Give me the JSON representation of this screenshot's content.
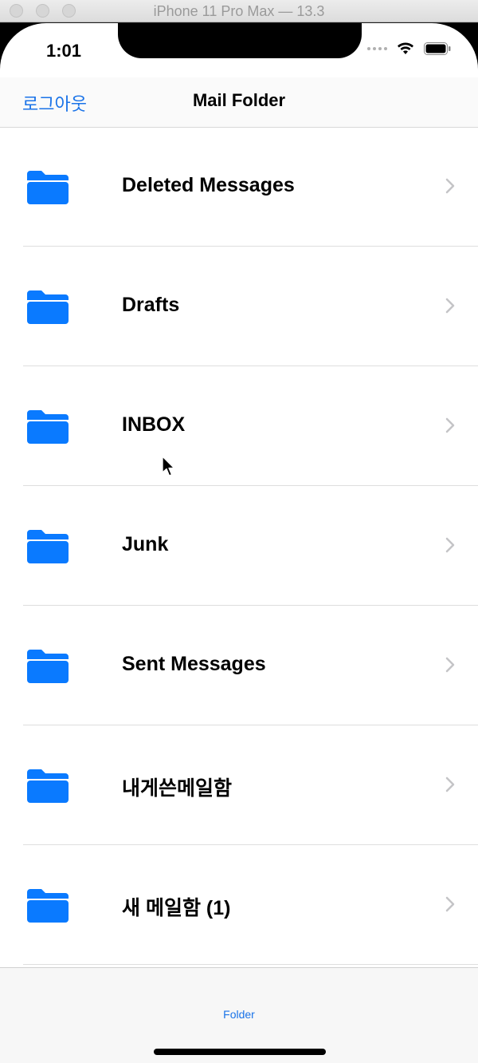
{
  "window": {
    "title": "iPhone 11 Pro Max — 13.3"
  },
  "status_bar": {
    "time": "1:01",
    "icons": [
      "cellular-dots-icon",
      "wifi-icon",
      "battery-icon"
    ]
  },
  "nav": {
    "left_button": "로그아웃",
    "title": "Mail Folder"
  },
  "folders": [
    {
      "label": "Deleted Messages",
      "icon": "folder-icon"
    },
    {
      "label": "Drafts",
      "icon": "folder-icon"
    },
    {
      "label": "INBOX",
      "icon": "folder-icon"
    },
    {
      "label": "Junk",
      "icon": "folder-icon"
    },
    {
      "label": "Sent Messages",
      "icon": "folder-icon"
    },
    {
      "label": "내게쓴메일함",
      "icon": "folder-icon"
    },
    {
      "label": "새 메일함 (1)",
      "icon": "folder-icon"
    }
  ],
  "tabbar": {
    "items": [
      {
        "label": "Folder"
      }
    ]
  },
  "colors": {
    "accent": "#1a73e8",
    "folder_icon": "#0a7aff"
  }
}
